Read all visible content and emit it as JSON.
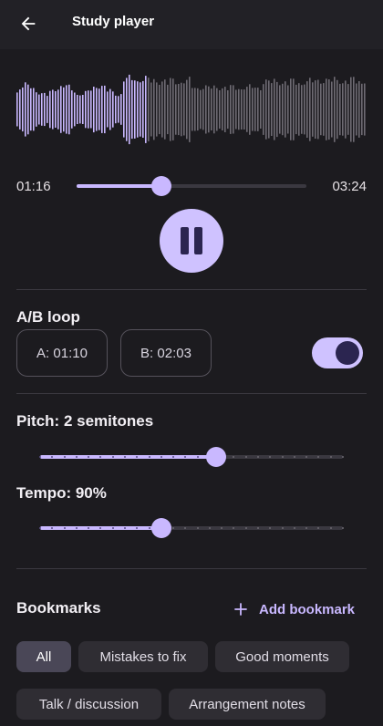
{
  "appbar": {
    "title": "Study player",
    "back_icon": "arrow-left-icon"
  },
  "player": {
    "current_time": "01:16",
    "total_time": "03:24",
    "progress": 0.37,
    "pause_icon": "pause-icon"
  },
  "loop": {
    "label": "A/B loop",
    "a_label": "A: 01:10",
    "b_label": "B: 02:03",
    "enabled": true
  },
  "pitch": {
    "label": "Pitch: 2 semitones",
    "value": 0.58,
    "steps": 25
  },
  "tempo": {
    "label": "Tempo: 90%",
    "value": 0.4,
    "steps": 25
  },
  "bookmarks": {
    "title": "Bookmarks",
    "add_label": "Add bookmark",
    "add_icon": "plus-icon",
    "chips": [
      {
        "label": "All",
        "selected": true
      },
      {
        "label": "Mistakes to fix",
        "selected": false
      },
      {
        "label": "Good moments",
        "selected": false
      },
      {
        "label": "Talk / discussion",
        "selected": false
      },
      {
        "label": "Arrangement notes",
        "selected": false
      }
    ]
  },
  "colors": {
    "accent": "#c9b8ff",
    "accent_dark": "#2b2550",
    "background": "#1c1b1f",
    "waveform_played": "#c9b8ff",
    "waveform_unplayed": "#6e6b73"
  }
}
